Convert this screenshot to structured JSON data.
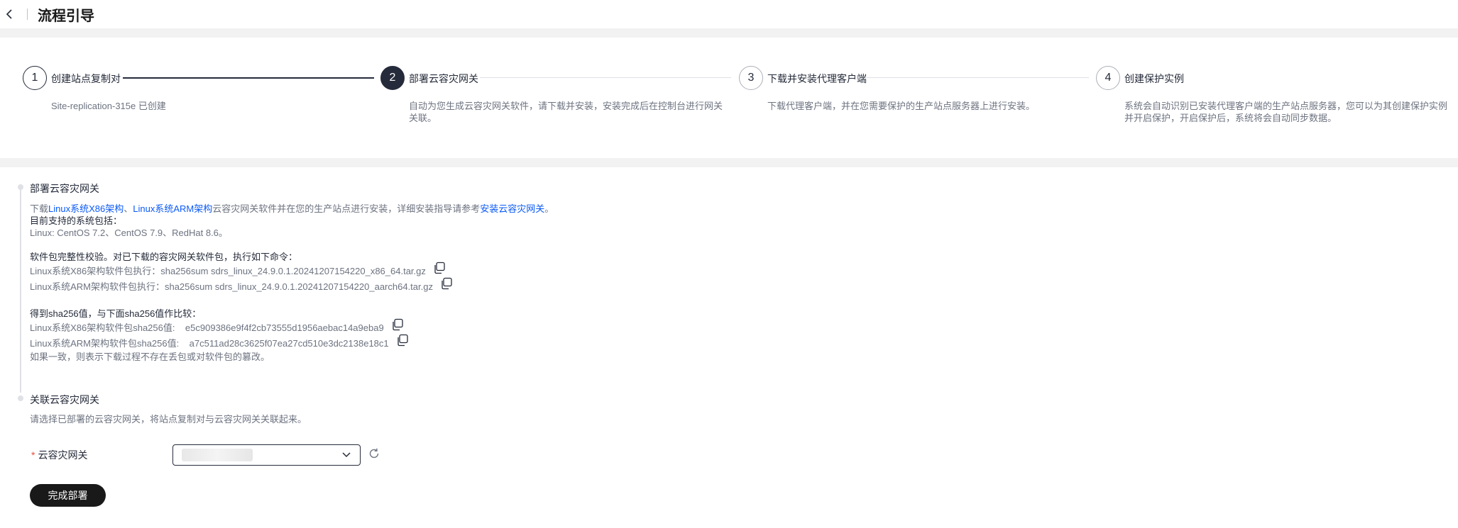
{
  "header": {
    "title": "流程引导",
    "back_icon": "chevron-left-icon"
  },
  "steps": [
    {
      "number": "1",
      "title": "创建站点复制对",
      "desc": "Site-replication-315e 已创建",
      "state": "done"
    },
    {
      "number": "2",
      "title": "部署云容灾网关",
      "desc": "自动为您生成云容灾网关软件，请下载并安装，安装完成后在控制台进行网关关联。",
      "state": "active"
    },
    {
      "number": "3",
      "title": "下载并安装代理客户端",
      "desc": "下载代理客户端，并在您需要保护的生产站点服务器上进行安装。",
      "state": "pending"
    },
    {
      "number": "4",
      "title": "创建保护实例",
      "desc": "系统会自动识别已安装代理客户端的生产站点服务器，您可以为其创建保护实例并开启保护，开启保护后，系统将会自动同步数据。",
      "state": "pending"
    }
  ],
  "deploy": {
    "title": "部署云容灾网关",
    "line1_prefix": "下载",
    "link_x86": "Linux系统X86架构",
    "sep": "、",
    "link_arm": "Linux系统ARM架构",
    "line1_middle": "云容灾网关软件并在您的生产站点进行安装，详细安装指导请参考",
    "link_guide": "安装云容灾网关",
    "line1_end": "。",
    "supported_title": "目前支持的系统包括：",
    "supported_list": "Linux: CentOS 7.2、CentOS 7.9、RedHat 8.6。",
    "verify_title": "软件包完整性校验。对已下载的容灾网关软件包，执行如下命令：",
    "cmd_x86": "Linux系统X86架构软件包执行：sha256sum sdrs_linux_24.9.0.1.20241207154220_x86_64.tar.gz",
    "cmd_arm": "Linux系统ARM架构软件包执行：sha256sum sdrs_linux_24.9.0.1.20241207154220_aarch64.tar.gz",
    "compare_title": "得到sha256值，与下面sha256值作比较：",
    "sha_x86": "Linux系统X86架构软件包sha256值:    e5c909386e9f4f2cb73555d1956aebac14a9eba9",
    "sha_arm": "Linux系统ARM架构软件包sha256值:    a7c511ad28c3625f07ea27cd510e3dc2138e18c1",
    "consistency_note": "如果一致，则表示下载过程不存在丢包或对软件包的篡改。"
  },
  "associate": {
    "title": "关联云容灾网关",
    "desc": "请选择已部署的云容灾网关，将站点复制对与云容灾网关关联起来。",
    "required_mark": "*",
    "field_label": "云容灾网关",
    "finish_button": "完成部署"
  },
  "colors": {
    "primary_dark": "#252b3a",
    "link": "#0a59f7",
    "required": "#e84e40",
    "muted": "#6d7380"
  }
}
